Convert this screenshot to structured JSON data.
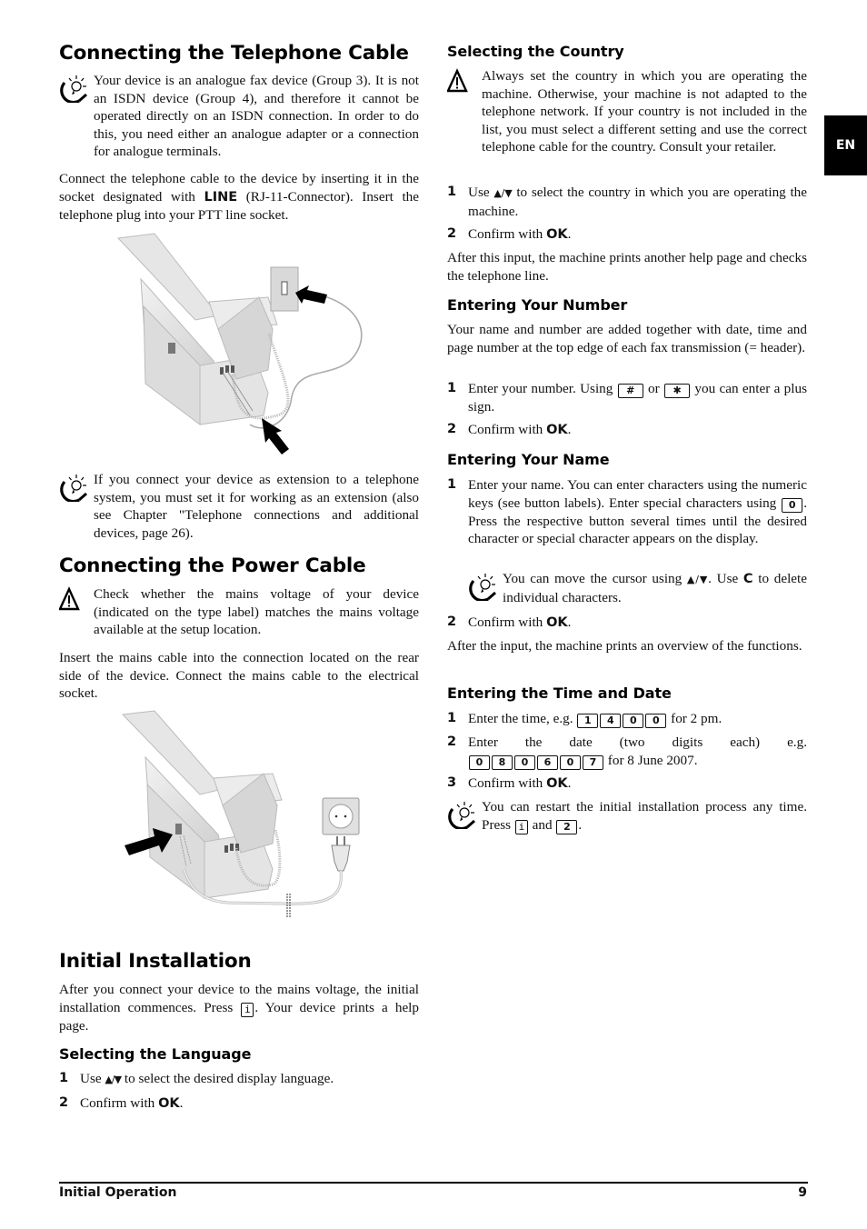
{
  "language_tab": "EN",
  "footer": {
    "section": "Initial Operation",
    "page_number": "9"
  },
  "left": {
    "telephone": {
      "title": "Connecting the Telephone Cable",
      "tip1": "Your device is an analogue fax device (Group 3). It is not an ISDN device (Group 4), and therefore it cannot be operated directly on an ISDN connection. In order to do this, you need either an analogue adapter or a connection for analogue terminals.",
      "para_pre": "Connect the telephone cable to the device by inserting it in the socket designated with ",
      "para_bold": "LINE",
      "para_post": " (RJ-11-Connector). Insert the telephone plug into your PTT line socket.",
      "illustration": "fax-telephone-cable-illustration",
      "tip2": "If you connect your device as extension to a telephone system, you must set it for working as an extension (also see Chapter \"Telephone connections and additional devices, page 26)."
    },
    "power": {
      "title": "Connecting the Power Cable",
      "warning": "Check whether the mains voltage of your device (indicated on the type label) matches the mains voltage available at the setup location.",
      "para": "Insert the mains cable into the connection located on the rear side of the device. Connect the mains cable to the electrical socket.",
      "illustration": "fax-power-cable-illustration"
    },
    "initial": {
      "title": "Initial Installation",
      "para_pre": "After you connect your device to the mains voltage, the initial installation commences. Press ",
      "para_key": "i",
      "para_post": ". Your device prints a help page."
    },
    "language": {
      "title": "Selecting the Language",
      "steps": [
        {
          "num": "1",
          "pre": "Use ",
          "arrows": "▲/▼",
          "post": " to select the desired display language."
        },
        {
          "num": "2",
          "pre": "Confirm with ",
          "bold": "OK",
          "post": "."
        }
      ]
    }
  },
  "right": {
    "country": {
      "title": "Selecting the Country",
      "warning": "Always set the country in which you are operating the machine. Otherwise, your machine is not adapted to the telephone network. If your country is not included in the list, you must select a different setting and use the correct telephone cable for the country. Consult your retailer.",
      "steps": [
        {
          "num": "1",
          "pre": "Use ",
          "arrows": "▲/▼",
          "post": " to select the country in which you are operating the machine."
        },
        {
          "num": "2",
          "pre": "Confirm with ",
          "bold": "OK",
          "post": "."
        }
      ],
      "after": "After this input, the machine prints another help page and checks the telephone line."
    },
    "number": {
      "title": "Entering Your Number",
      "para": "Your name and number are added together with date, time and page number at the top edge of each fax transmission (= header).",
      "steps": [
        {
          "num": "1",
          "pre": "Enter your number. Using ",
          "key1": "#",
          "mid": " or ",
          "key2": "✱",
          "post": " you can enter a plus sign."
        },
        {
          "num": "2",
          "pre": "Confirm with ",
          "bold": "OK",
          "post": "."
        }
      ]
    },
    "name": {
      "title": "Entering Your Name",
      "steps": [
        {
          "num": "1",
          "pre": "Enter your name. You can enter characters using the numeric keys (see button labels).  Enter special characters using ",
          "key": "0",
          "post": ". Press the respective button several times until the desired character or special character appears on the display."
        },
        {
          "num": "2",
          "pre": "Confirm with ",
          "bold": "OK",
          "post": "."
        }
      ],
      "tip_pre": "You can move the cursor using ",
      "tip_arrows": "▲/▼",
      "tip_mid": ". Use ",
      "tip_bold": "C",
      "tip_post": " to delete individual characters.",
      "after": "After the input, the machine prints an overview of the functions."
    },
    "timedate": {
      "title": "Entering the Time and Date",
      "step1_pre": "Enter the time, e.g. ",
      "step1_keys": [
        "1",
        "4",
        "0",
        "0"
      ],
      "step1_post": " for 2 pm.",
      "step2_pre": "Enter the date (two digits each) e.g. ",
      "step2_keys": [
        "0",
        "8",
        "0",
        "6",
        "0",
        "7"
      ],
      "step2_post": " for 8 June 2007.",
      "step3_pre": "Confirm with ",
      "step3_bold": "OK",
      "step3_post": ".",
      "nums": [
        "1",
        "2",
        "3"
      ],
      "tip_pre": "You can restart the initial installation process any time. Press ",
      "tip_key1": "i",
      "tip_mid": " and ",
      "tip_key2": "2",
      "tip_post": "."
    }
  }
}
